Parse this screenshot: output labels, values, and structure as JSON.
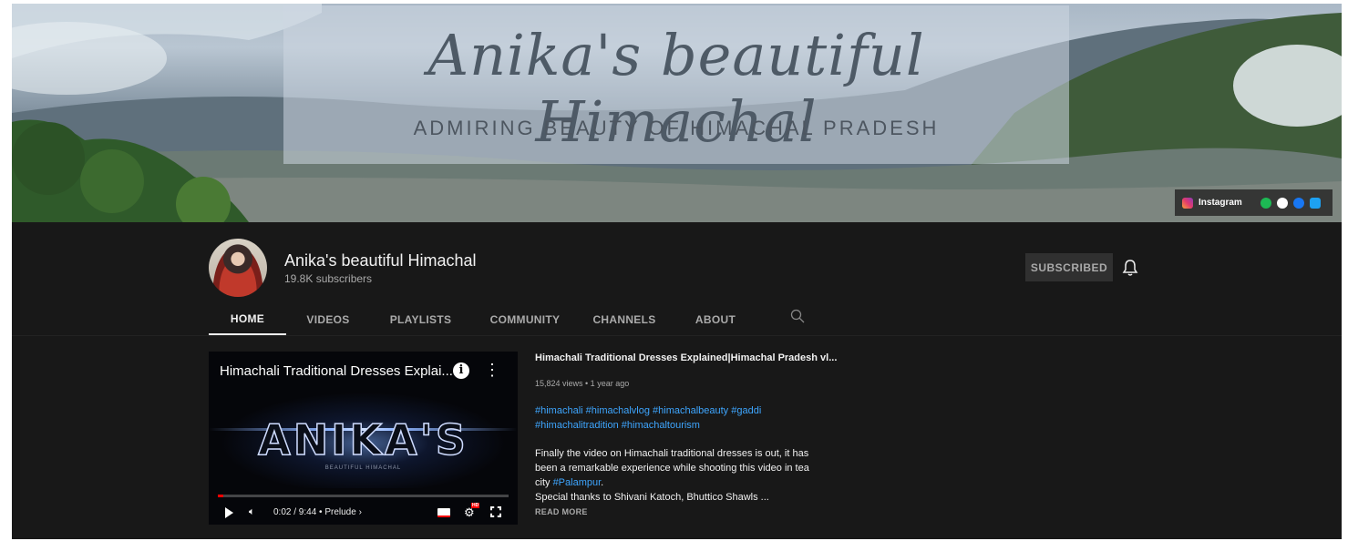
{
  "banner": {
    "title": "Anika's beautiful Himachal",
    "subtitle": "ADMIRING BEAUTY OF HIMACHAL PRADESH",
    "social": {
      "instagram_label": "Instagram",
      "icons": [
        "instagram-icon",
        "spotify-icon",
        "google-icon",
        "facebook-icon",
        "twitter-icon"
      ],
      "colors": {
        "spotify": "#1db954",
        "google": "#ffffff",
        "facebook": "#1877f2",
        "twitter": "#1da1f2"
      }
    }
  },
  "channel": {
    "name": "Anika's beautiful Himachal",
    "subscribers": "19.8K subscribers",
    "subscribe_label": "SUBSCRIBED"
  },
  "tabs": [
    {
      "label": "HOME",
      "active": true
    },
    {
      "label": "VIDEOS",
      "active": false
    },
    {
      "label": "PLAYLISTS",
      "active": false
    },
    {
      "label": "COMMUNITY",
      "active": false
    },
    {
      "label": "CHANNELS",
      "active": false
    },
    {
      "label": "ABOUT",
      "active": false
    }
  ],
  "featured_video": {
    "player_title": "Himachali Traditional Dresses Explai...",
    "logo_text": "ANIKA'S",
    "logo_sub": "BEAUTIFUL HIMACHAL",
    "time": "0:02 / 9:44",
    "chapter": "• Prelude",
    "progress_fraction": 0.0035,
    "title": "Himachali Traditional Dresses Explained|Himachal Pradesh vl...",
    "meta": "15,824 views • 1 year ago",
    "hashtags_line1": "#himachali #himachalvlog #himachalbeauty #gaddi",
    "hashtags_line2": "#himachalitradition #himachaltourism",
    "desc_line1": "Finally the video on Himachali traditional dresses is out, it has",
    "desc_line2": "been a remarkable experience while shooting this video in tea",
    "desc_line3_prefix": "city ",
    "desc_line3_link": "#Palampur",
    "desc_line3_suffix": ".",
    "desc_line4": "Special thanks to Shivani Katoch, Bhuttico Shawls ...",
    "read_more": "READ MORE"
  },
  "colors": {
    "background": "#181818",
    "link": "#3ea6ff",
    "progress": "#ff0000"
  }
}
